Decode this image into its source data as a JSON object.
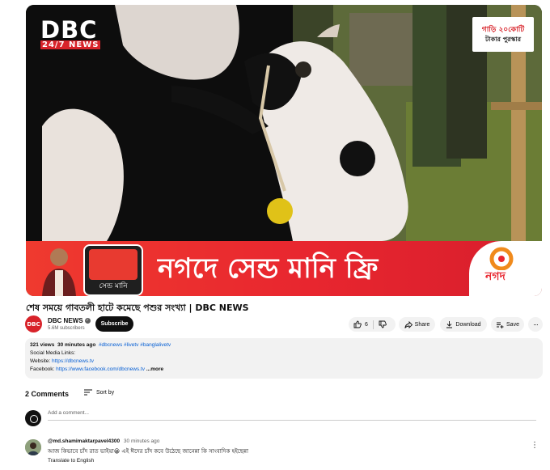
{
  "player": {
    "logo_main": "DBC",
    "logo_sub": "24/7 NEWS",
    "badge_line1": "গাড়ি ২০কোটি",
    "badge_line2": "টাকার পুরস্কার",
    "banner_text": "নগদে সেন্ড মানি ফ্রি",
    "banner_phone_label": "সেন্ড মানি",
    "banner_brand": "নগদ"
  },
  "video": {
    "title": "শেষ সময়ে গাবতলী হাটে কমেছে পশুর সংখ্যা | DBC NEWS"
  },
  "channel": {
    "avatar_text": "DBC",
    "name": "DBC NEWS",
    "subscribers": "5.6M subscribers",
    "subscribe_label": "Subscribe"
  },
  "actions": {
    "like_count": "6",
    "share_label": "Share",
    "download_label": "Download",
    "save_label": "Save",
    "more_label": "···"
  },
  "description": {
    "views": "321 views",
    "time": "30 minutes ago",
    "tags": "#dbcnews #livetv #banglalivetv",
    "line2": "Social Media Links:",
    "website_label": "Website:",
    "website_url": "https://dbcnews.tv",
    "facebook_label": "Facebook:",
    "facebook_url": "https://www.facebook.com/dbcnews.tv",
    "more": "...more"
  },
  "comments": {
    "count_label": "2 Comments",
    "sort_label": "Sort by",
    "add_placeholder": "Add a comment...",
    "items": [
      {
        "author": "@md.shamimaktarpavel4300",
        "time": "30 minutes ago",
        "text": "আজ কিভাবে চাঁদ রাত ভাইয়া😀 এই ঈদের চাঁদ কবে উঠেছে জানেন্না কি সাংবাদিক হইছেন্না",
        "translate": "Translate to English"
      }
    ]
  },
  "colors": {
    "brand_red": "#d8232a",
    "link_blue": "#065fd4"
  }
}
